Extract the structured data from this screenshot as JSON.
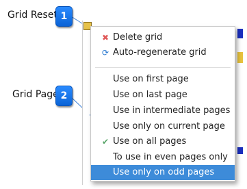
{
  "callouts": [
    {
      "number": "1",
      "label": "Grid Reset"
    },
    {
      "number": "2",
      "label": "Grid Page"
    }
  ],
  "menu": {
    "actions": [
      {
        "label": "Delete grid",
        "icon": "delete-icon"
      },
      {
        "label": "Auto-regenerate grid",
        "icon": "regenerate-icon"
      }
    ],
    "page_options": [
      {
        "label": "Use on first page",
        "checked": false
      },
      {
        "label": "Use on last page",
        "checked": false
      },
      {
        "label": "Use in intermediate pages",
        "checked": false
      },
      {
        "label": "Use only on current page",
        "checked": false
      },
      {
        "label": "Use on all pages",
        "checked": true
      },
      {
        "label": "To use in even pages only",
        "checked": false
      },
      {
        "label": "Use only on odd pages",
        "checked": false,
        "highlighted": true
      }
    ],
    "checkmark": "✔"
  },
  "colors": {
    "badge": "#1a76f0",
    "highlight": "#3d8bd9"
  }
}
